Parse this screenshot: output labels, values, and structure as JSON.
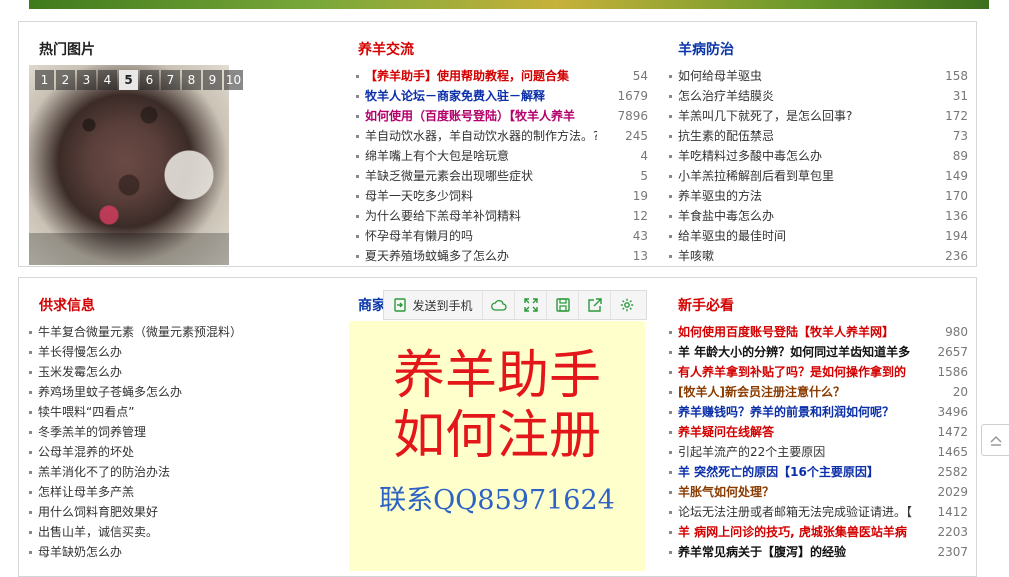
{
  "hot_pics": {
    "title": "热门图片",
    "pages": [
      "1",
      "2",
      "3",
      "4",
      "5",
      "6",
      "7",
      "8",
      "9",
      "10"
    ],
    "active_page": "5"
  },
  "exchange": {
    "title": "养羊交流",
    "items": [
      {
        "text": "【养羊助手】使用帮助教程，问题合集",
        "count": "54",
        "style": "bold c-red"
      },
      {
        "text": "牧羊人论坛－商家免费入驻－解释",
        "count": "1679",
        "style": "bold c-blue"
      },
      {
        "text": "如何使用（百度账号登陆）【牧羊人养羊",
        "count": "7896",
        "style": "bold c-purple"
      },
      {
        "text": "羊自动饮水器，羊自动饮水器的制作方法。?",
        "count": "245",
        "style": "c-gray"
      },
      {
        "text": "绵羊嘴上有个大包是啥玩意",
        "count": "4",
        "style": "c-gray"
      },
      {
        "text": "羊缺乏微量元素会出现哪些症状",
        "count": "5",
        "style": "c-gray"
      },
      {
        "text": "母羊一天吃多少饲料",
        "count": "19",
        "style": "c-gray"
      },
      {
        "text": "为什么要给下羔母羊补饲精料",
        "count": "12",
        "style": "c-gray"
      },
      {
        "text": "怀孕母羊有懒月的吗",
        "count": "43",
        "style": "c-gray"
      },
      {
        "text": "夏天养殖场蚊蝇多了怎么办",
        "count": "13",
        "style": "c-gray"
      }
    ]
  },
  "disease": {
    "title": "羊病防治",
    "items": [
      {
        "text": "如何给母羊驱虫",
        "count": "158"
      },
      {
        "text": "怎么治疗羊结膜炎",
        "count": "31"
      },
      {
        "text": "羊羔叫几下就死了，是怎么回事?",
        "count": "172"
      },
      {
        "text": "抗生素的配伍禁忌",
        "count": "73"
      },
      {
        "text": "羊吃精料过多酸中毒怎么办",
        "count": "89"
      },
      {
        "text": "小羊羔拉稀解剖后看到草包里",
        "count": "149"
      },
      {
        "text": "养羊驱虫的方法",
        "count": "170"
      },
      {
        "text": "羊食盐中毒怎么办",
        "count": "136"
      },
      {
        "text": "给羊驱虫的最佳时间",
        "count": "194"
      },
      {
        "text": "羊咳嗽",
        "count": "236"
      }
    ]
  },
  "supply": {
    "title": "供求信息",
    "items": [
      "牛羊复合微量元素（微量元素预混料）",
      "羊长得慢怎么办",
      "玉米发霉怎么办",
      "养鸡场里蚊子苍蝇多怎么办",
      "犊牛喂料“四看点”",
      "冬季羔羊的饲养管理",
      "公母羊混养的坏处",
      "羔羊消化不了的防治办法",
      "怎样让母羊多产羔",
      "用什么饲料育肥效果好",
      "出售山羊，诚信买卖。",
      "母羊缺奶怎么办"
    ]
  },
  "merchant": {
    "title": "商家"
  },
  "ad": {
    "line1": "养羊助手",
    "line2": "如何注册",
    "line3": "联系QQ85971624"
  },
  "toolbar": {
    "send_label": "发送到手机"
  },
  "newbie": {
    "title": "新手必看",
    "items": [
      {
        "text": "如何使用百度账号登陆【牧羊人养羊网】",
        "count": "980",
        "style": "bold c-red"
      },
      {
        "text": "羊 年龄大小的分辨？如何同过羊齿知道羊多",
        "count": "2657",
        "style": "bold c-black"
      },
      {
        "text": "有人养羊拿到补贴了吗？是如何操作拿到的",
        "count": "1586",
        "style": "bold c-red"
      },
      {
        "text": "[牧羊人]新会员注册注意什么？",
        "count": "20",
        "style": "bold c-brown"
      },
      {
        "text": "养羊赚钱吗？养羊的前景和利润如何呢？",
        "count": "3496",
        "style": "bold c-blue"
      },
      {
        "text": "养羊疑问在线解答",
        "count": "1472",
        "style": "bold c-red"
      },
      {
        "text": "引起羊流产的22个主要原因",
        "count": "1465",
        "style": "c-gray"
      },
      {
        "text": "羊 突然死亡的原因【16个主要原因】",
        "count": "2582",
        "style": "bold c-blue"
      },
      {
        "text": "羊胀气如何处理？",
        "count": "2029",
        "style": "bold c-brown"
      },
      {
        "text": "论坛无法注册或者邮箱无法完成验证请进。【",
        "count": "1412",
        "style": "c-gray"
      },
      {
        "text": "羊 病网上问诊的技巧, 虎城张集兽医站羊病",
        "count": "2203",
        "style": "bold c-red"
      },
      {
        "text": "养羊常见病关于【腹泻】的经验",
        "count": "2307",
        "style": "bold c-black"
      }
    ]
  }
}
